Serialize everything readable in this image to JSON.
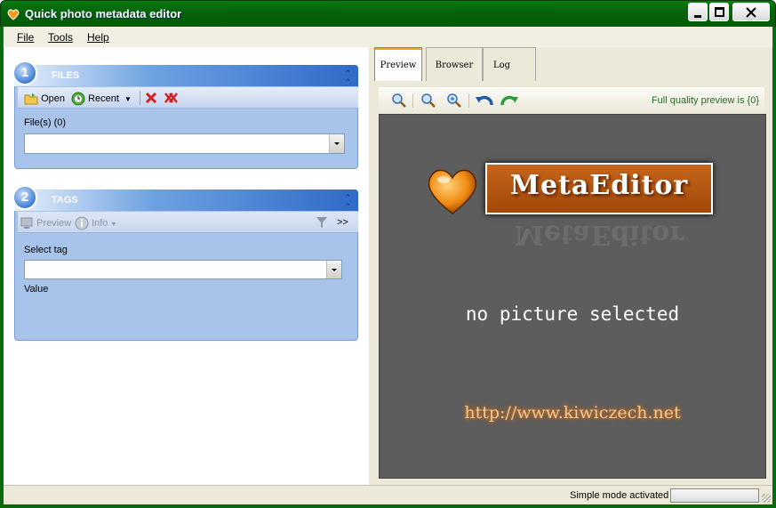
{
  "window": {
    "title": "Quick photo metadata editor"
  },
  "menu": {
    "file": "File",
    "tools": "Tools",
    "help": "Help"
  },
  "files_panel": {
    "number": "1",
    "title": "FILES",
    "toolbar": {
      "open": "Open",
      "recent": "Recent"
    },
    "files_label": "File(s) (0)",
    "files_value": ""
  },
  "tags_panel": {
    "number": "2",
    "title": "TAGS",
    "toolbar": {
      "preview": "Preview",
      "info": "Info",
      "more": ">>"
    },
    "select_tag_label": "Select tag",
    "select_tag_value": "",
    "value_label": "Value"
  },
  "tabs": [
    {
      "label": "Preview",
      "active": true
    },
    {
      "label": "Browser",
      "active": false
    },
    {
      "label": "Log",
      "active": false
    }
  ],
  "preview_toolbar": {
    "quality_text": "Full quality preview is {0}"
  },
  "preview": {
    "logo_text": "MetaEditor",
    "message": "no picture selected",
    "url": "http://www.kiwiczech.net"
  },
  "statusbar": {
    "text": "Simple mode activated",
    "progress": 0
  },
  "colors": {
    "title_bar": "#05620a",
    "panel": "#a9c4ea",
    "accent_orange": "#c4651b",
    "preview_bg": "#5d5d5d"
  }
}
